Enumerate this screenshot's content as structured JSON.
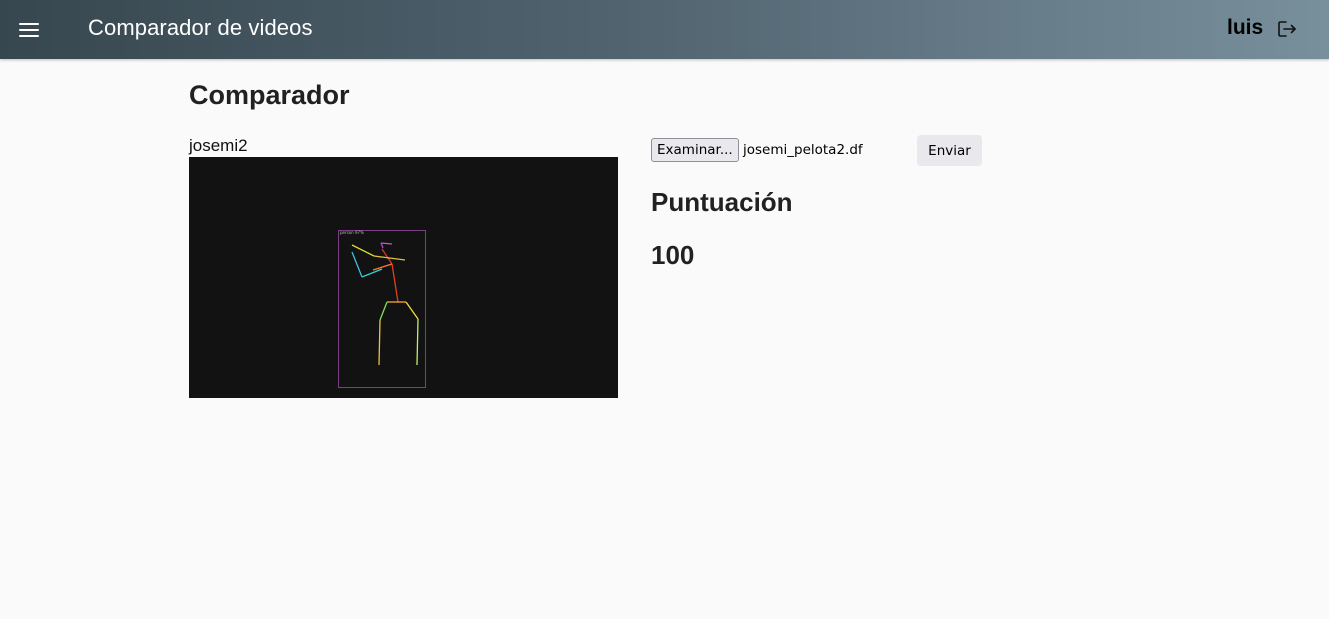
{
  "header": {
    "menu_icon": "hamburger-menu-icon",
    "title": "Comparador de videos",
    "user": "luis",
    "logout_icon": "logout-icon"
  },
  "main": {
    "page_title": "Comparador",
    "video": {
      "label": "josemi2",
      "overlay_text": "person 97%",
      "background": "#121212"
    },
    "upload": {
      "browse_label": "Examinar...",
      "file_name": "josemi_pelota2.df",
      "send_label": "Enviar"
    },
    "score": {
      "heading": "Puntuación",
      "value": "100"
    }
  },
  "colors": {
    "header_gradient_start": "#37474f",
    "header_gradient_end": "#78909c",
    "page_background": "#fafafa",
    "button_background": "#e9e9ed"
  }
}
